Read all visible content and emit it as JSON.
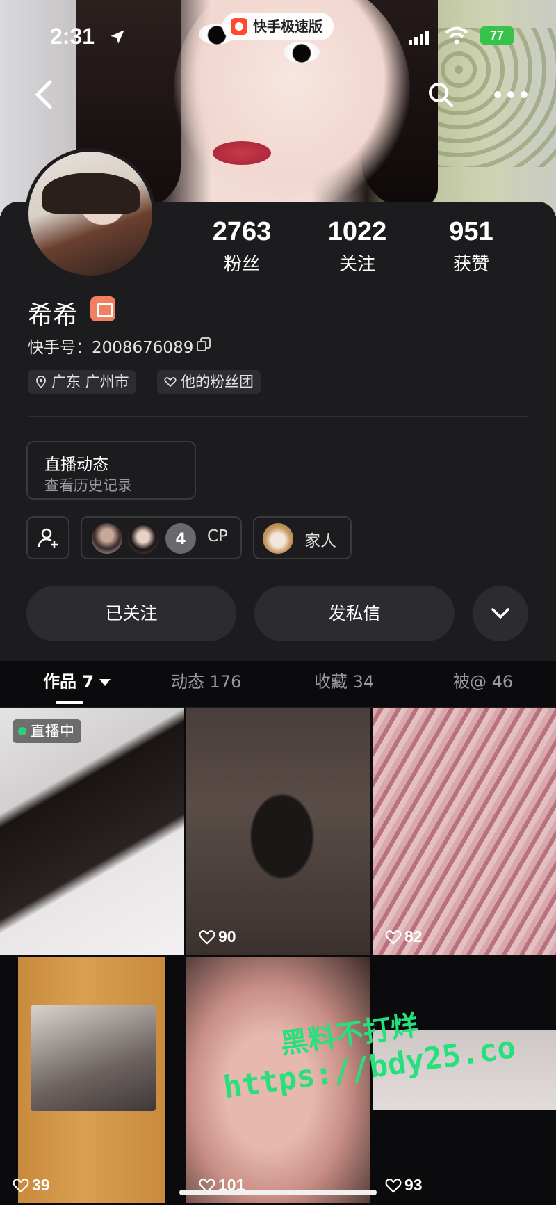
{
  "status_bar": {
    "time": "2:31",
    "battery": "77"
  },
  "app_pill": {
    "label": "快手极速版"
  },
  "profile": {
    "stats": [
      {
        "value": "2763",
        "label": "粉丝"
      },
      {
        "value": "1022",
        "label": "关注"
      },
      {
        "value": "951",
        "label": "获赞"
      }
    ],
    "name": "希希",
    "kuaishou_id": "快手号：2008676089",
    "tags": {
      "location": "广东 广州市",
      "fan_club": "他的粉丝团"
    },
    "live_card": {
      "title": "直播动态",
      "subtitle": "查看历史记录"
    },
    "relations": {
      "cp_count": "4",
      "cp_label": "CP",
      "family_label": "家人"
    },
    "buttons": {
      "follow": "已关注",
      "message": "发私信"
    }
  },
  "tabs": {
    "works": "作品 7",
    "moments": "动态 176",
    "favorites": "收藏 34",
    "mentioned": "被@ 46"
  },
  "grid": {
    "live_label": "直播中",
    "likes": [
      "90",
      "82",
      "39",
      "101",
      "93"
    ]
  },
  "watermark": {
    "line1": "黑料不打烊",
    "line2": "https://bdy25.co"
  },
  "colors": {
    "accent_green": "#27e07c",
    "card_bg": "#1c1c1f",
    "battery_green": "#37c24a"
  }
}
